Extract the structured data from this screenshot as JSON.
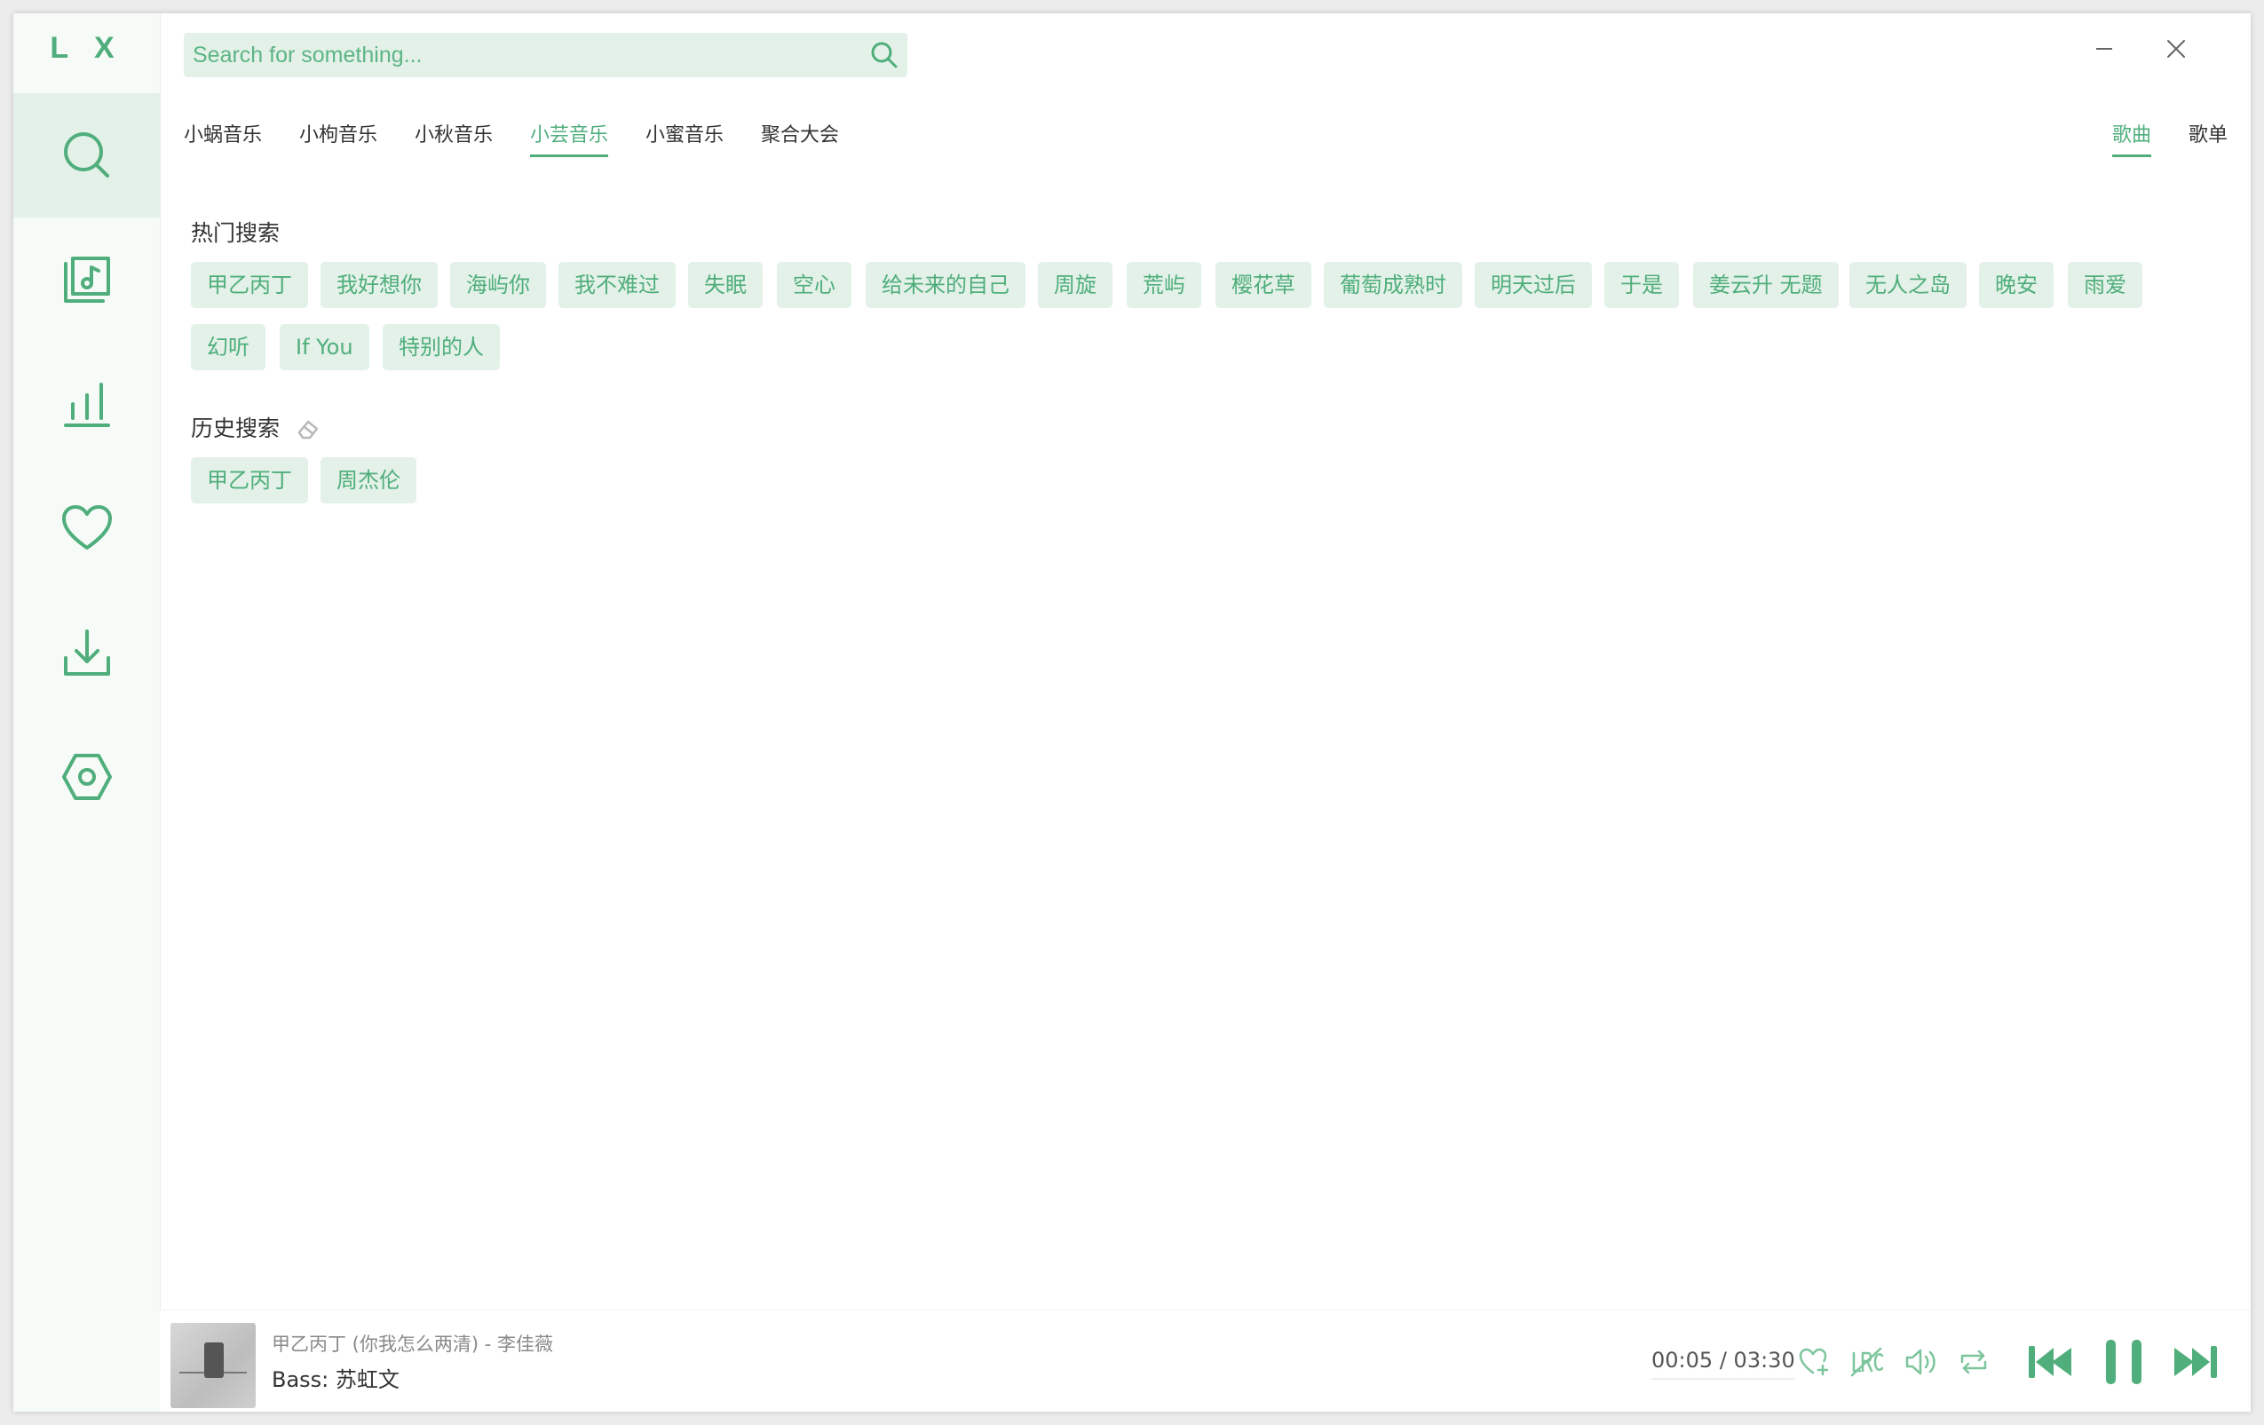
{
  "app": {
    "logo": "L X"
  },
  "sidebar": {
    "items": [
      {
        "name": "search",
        "icon": "search-icon",
        "active": true
      },
      {
        "name": "song-list",
        "icon": "music-file-icon",
        "active": false
      },
      {
        "name": "leaderboard",
        "icon": "bar-chart-icon",
        "active": false
      },
      {
        "name": "my-list",
        "icon": "heart-icon",
        "active": false
      },
      {
        "name": "download",
        "icon": "download-icon",
        "active": false
      },
      {
        "name": "settings",
        "icon": "hexagon-settings-icon",
        "active": false
      }
    ]
  },
  "search": {
    "placeholder": "Search for something..."
  },
  "sources": {
    "tabs": [
      "小蜗音乐",
      "小枸音乐",
      "小秋音乐",
      "小芸音乐",
      "小蜜音乐",
      "聚合大会"
    ],
    "active_index": 3
  },
  "type_tabs": {
    "song": "歌曲",
    "playlist": "歌单",
    "active": "song"
  },
  "hot_search": {
    "title": "热门搜索",
    "tags": [
      "甲乙丙丁",
      "我好想你",
      "海屿你",
      "我不难过",
      "失眠",
      "空心",
      "给未来的自己",
      "周旋",
      "荒屿",
      "樱花草",
      "葡萄成熟时",
      "明天过后",
      "于是",
      "姜云升 无题",
      "无人之岛",
      "晚安",
      "雨爱",
      "幻听",
      "If You",
      "特别的人"
    ]
  },
  "history_search": {
    "title": "历史搜索",
    "tags": [
      "甲乙丙丁",
      "周杰伦"
    ]
  },
  "player": {
    "title": "甲乙丙丁 (你我怎么两清) - 李佳薇",
    "lyric": "Bass: 苏虹文",
    "current_time": "00:05",
    "separator": "/",
    "total_time": "03:30",
    "progress": 0.024
  },
  "colors": {
    "accent": "#4fae7b",
    "accent_light": "#e3f1e8"
  }
}
